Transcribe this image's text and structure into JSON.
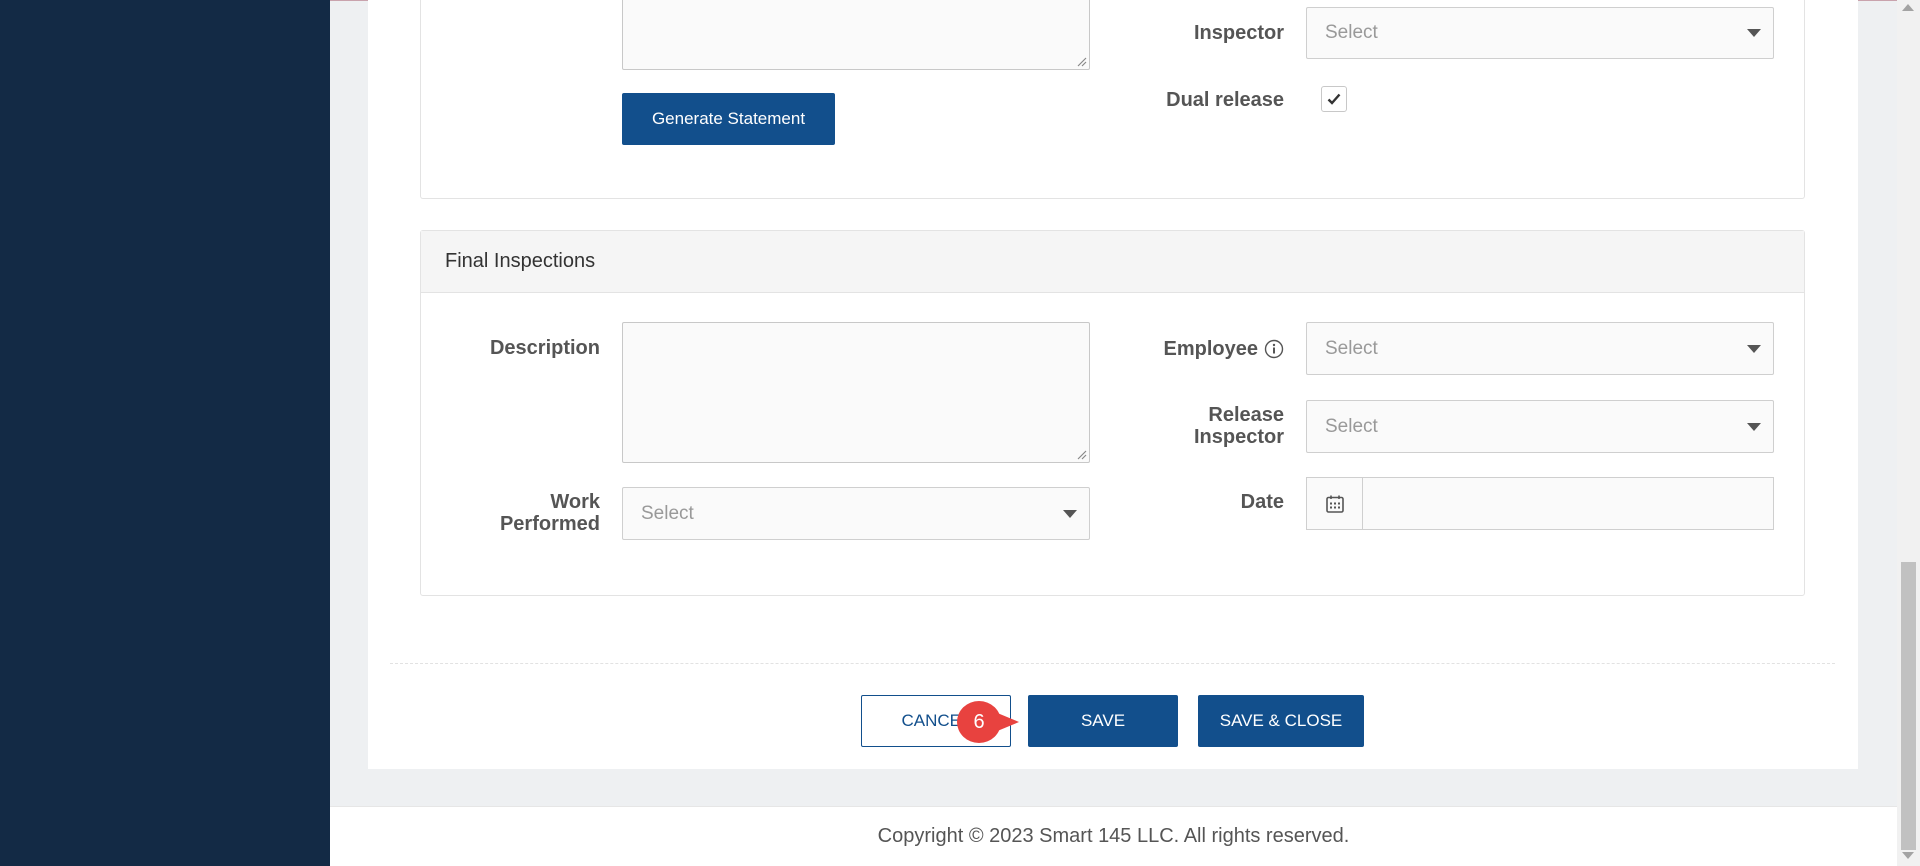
{
  "top_panel": {
    "inspector_label": "Inspector",
    "inspector_placeholder": "Select",
    "dual_release_label": "Dual release",
    "dual_release_checked": true,
    "generate_statement_label": "Generate Statement"
  },
  "final_inspections": {
    "title": "Final Inspections",
    "description_label": "Description",
    "work_performed_label_line1": "Work",
    "work_performed_label_line2": "Performed",
    "work_performed_placeholder": "Select",
    "employee_label": "Employee",
    "employee_placeholder": "Select",
    "release_inspector_label_line1": "Release",
    "release_inspector_label_line2": "Inspector",
    "release_inspector_placeholder": "Select",
    "date_label": "Date",
    "date_value": ""
  },
  "actions": {
    "cancel_label": "CANCEL",
    "save_label": "SAVE",
    "save_close_label": "SAVE & CLOSE"
  },
  "step_badge": "6",
  "footer": {
    "copyright": "Copyright © 2023 Smart 145 LLC. All rights reserved."
  },
  "colors": {
    "sidebar": "#132a45",
    "primary": "#124f8c",
    "badge": "#e8423f"
  }
}
